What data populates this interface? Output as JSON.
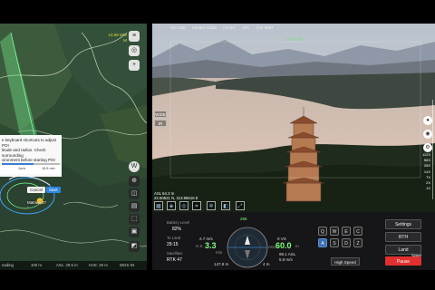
{
  "map": {
    "readout_lines": [
      "13.69 M/S",
      "M"
    ],
    "controls": {
      "layers_icon": "layers-icon",
      "locate_icon": "locate-icon",
      "add_icon": "plus-icon"
    },
    "hint": {
      "lines": [
        "e keyboard shortcuts to adjust POI",
        "titude and radius. Check surrounding",
        "vironment before starting POI"
      ],
      "stats": [
        "1m/s",
        "15.5 min"
      ],
      "cancel_label": "Cancel",
      "start_label": "Start"
    },
    "waypoint_label": [
      "Matrice 4T",
      "-"
    ],
    "status_bar": {
      "mode": "eading",
      "scale": "100 m",
      "asl": "ASL: 29.5 m",
      "hae": "HAE: 26 m",
      "datum": "WGS 84"
    }
  },
  "video": {
    "status": [
      "ISO 250",
      "Shutter 1/200",
      "0.0 EV",
      "AFC",
      "CVI 9887"
    ],
    "zoom_label": "Zoom 4x",
    "chips": [
      "WIDE",
      "IR"
    ],
    "zoom_scale": [
      "112X",
      "56X",
      "28X",
      "14X",
      "7X",
      "2X",
      "1X"
    ],
    "altitude_lines": [
      "ASL 64.3 m",
      "22.60521 N, 113.96616 E"
    ],
    "tool_icons": [
      "grid-icon",
      "camera-icon",
      "target-icon",
      "crop-icon",
      "settings-icon",
      "layers-icon",
      "expand-icon"
    ],
    "right_icons": [
      "mic-icon",
      "record-icon",
      "gear-icon"
    ]
  },
  "bottom": {
    "battery_label": "Battery Level",
    "battery_value": "82%",
    "to_land_label": "To Land",
    "to_land_value": "29:15",
    "satellites_label": "Satellites",
    "satellites_value": "RTK 47",
    "heading_value": "266",
    "hs_label": "H.S",
    "hs_value": "3.3",
    "vs_label": "0 VS",
    "alt_value": "60.0",
    "alt_unit": "m",
    "ag_label": "AGL",
    "speed_unit": "m/s",
    "vs_value": "2.7 m/s",
    "home_dist": "147.8 m",
    "home_alt": "4 m",
    "asl_lines": [
      "98.1 ASL",
      "5.9 m/s"
    ],
    "keys": [
      "Q",
      "W",
      "E",
      "C",
      "A",
      "S",
      "D",
      "Z"
    ],
    "speed_mode": "High Speed",
    "buttons": [
      "Settings",
      "RTH",
      "Land",
      "Pause"
    ],
    "space_label": "Space"
  }
}
